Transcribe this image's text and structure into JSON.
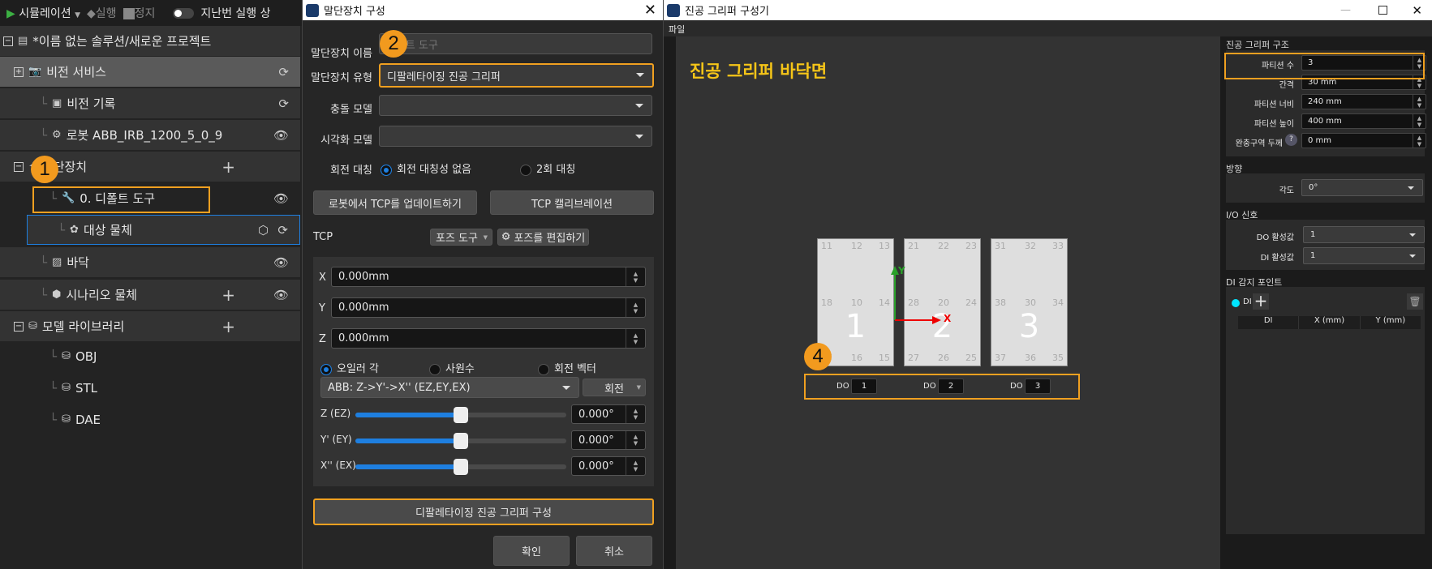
{
  "toolbar": {
    "simulation": "시뮬레이션",
    "run": "실행",
    "stop": "정지",
    "last_run": "지난번 실행 상"
  },
  "tree": [
    {
      "label": "*이름 없는 솔루션/새로운 프로젝트",
      "icon": "folder-icon",
      "indent": 0,
      "expander": "minus"
    },
    {
      "label": "비전 서비스",
      "icon": "camera-icon",
      "indent": 1,
      "expander": "plus",
      "right": [
        "refresh-icon"
      ]
    },
    {
      "label": "비전 기록",
      "icon": "vision-record-icon",
      "indent": 2,
      "right": [
        "refresh-icon"
      ]
    },
    {
      "label": "로봇 ABB_IRB_1200_5_0_9",
      "icon": "robot-arm-icon",
      "indent": 2,
      "right": [
        "eye-icon"
      ]
    },
    {
      "label": "말단장치",
      "icon": "end-effector-icon",
      "indent": 1,
      "expander": "minus",
      "right2": "plus-icon"
    },
    {
      "label": "0. 디폴트 도구",
      "icon": "wrench-icon",
      "indent": 3,
      "right": [
        "eye-icon"
      ],
      "dark": true
    },
    {
      "label": "대상 물체",
      "icon": "object-icon",
      "indent": 2,
      "right": [
        "refresh-icon"
      ],
      "right2": "hexagon-icon",
      "selected": true
    },
    {
      "label": "바닥",
      "icon": "floor-icon",
      "indent": 2,
      "right": [
        "eye-icon"
      ]
    },
    {
      "label": "시나리오 물체",
      "icon": "scene-object-icon",
      "indent": 2,
      "right": [
        "eye-icon"
      ],
      "right2": "plus-icon"
    },
    {
      "label": "모델 라이브러리",
      "icon": "database-icon",
      "indent": 1,
      "expander": "minus",
      "right2": "plus-icon"
    },
    {
      "label": "OBJ",
      "icon": "database-icon",
      "indent": 3,
      "dark": true
    },
    {
      "label": "STL",
      "icon": "database-icon",
      "indent": 3,
      "dark": true
    },
    {
      "label": "DAE",
      "icon": "database-icon",
      "indent": 3,
      "dark": true
    }
  ],
  "dialog": {
    "title": "말단장치 구성",
    "name_label": "말단장치 이름",
    "name_value": "디폴트 도구",
    "type_label": "말단장치 유형",
    "type_value": "디팔레타이징 진공 그리퍼",
    "collision_label": "충돌 모델",
    "collision_value": "",
    "visual_label": "시각화 모델",
    "visual_value": "",
    "symmetry_label": "회전 대칭",
    "sym_opt1": "회전 대칭성 없음",
    "sym_opt2": "2회 대칭",
    "update_tcp": "로봇에서 TCP를 업데이트하기",
    "tcp_calib": "TCP 캘리브레이션",
    "tcp_label": "TCP",
    "pose_tool": "포즈 도구",
    "edit_pose": "포즈를 편집하기",
    "x_label": "X",
    "x_value": "0.000mm",
    "y_label": "Y",
    "y_value": "0.000mm",
    "z_label": "Z",
    "z_value": "0.000mm",
    "rot_opt1": "오일러 각",
    "rot_opt2": "사원수",
    "rot_opt3": "회전 벡터",
    "euler_conv": "ABB: Z->Y'->X'' (EZ,EY,EX)",
    "rotate": "회전",
    "angles": [
      {
        "label": "Z (EZ)",
        "value": "0.000°",
        "slider": 0.5
      },
      {
        "label": "Y' (EY)",
        "value": "0.000°",
        "slider": 0.5
      },
      {
        "label": "X'' (EX)",
        "value": "0.000°",
        "slider": 0.5
      }
    ],
    "configure": "디팔레타이징 진공 그리퍼 구성",
    "ok": "확인",
    "cancel": "취소"
  },
  "configurator": {
    "title": "진공 그리퍼 구성기",
    "menu_file": "파일",
    "canvas_title": "진공 그리퍼 바닥면",
    "partitions": [
      {
        "label": "1",
        "points": [
          "11",
          "12",
          "13",
          "18",
          "10",
          "14",
          "17",
          "16",
          "15"
        ],
        "do": "1"
      },
      {
        "label": "2",
        "points": [
          "21",
          "22",
          "23",
          "28",
          "20",
          "24",
          "27",
          "26",
          "25"
        ],
        "do": "2"
      },
      {
        "label": "3",
        "points": [
          "31",
          "32",
          "33",
          "38",
          "30",
          "34",
          "37",
          "36",
          "35"
        ],
        "do": "3"
      }
    ],
    "do_label": "DO",
    "axis_x": "X",
    "axis_y": "Y",
    "structure": {
      "header": "진공 그리퍼 구조",
      "count_label": "파티션 수",
      "count": "3",
      "gap_label": "간격",
      "gap": "30 mm",
      "width_label": "파티션 너비",
      "width": "240 mm",
      "height_label": "파티션 높이",
      "height": "400 mm",
      "buffer_label": "완충구역 두께",
      "buffer": "0 mm"
    },
    "direction": {
      "header": "방향",
      "angle_label": "각도",
      "angle": "0°"
    },
    "io": {
      "header": "I/O 신호",
      "do_label": "DO 활성값",
      "do_value": "1",
      "di_label": "DI 활성값",
      "di_value": "1"
    },
    "di_points": {
      "header": "DI 감지 포인트",
      "di": "DI",
      "cols": [
        "DI",
        "X (mm)",
        "Y (mm)"
      ]
    }
  },
  "badges": [
    "1",
    "2",
    "4"
  ],
  "colors": {
    "accent": "#f29a1e",
    "highlight": "#f0a020",
    "selection": "#1e7fe0",
    "title_yellow": "#f5c518",
    "di_dot": "#00e5ff"
  }
}
